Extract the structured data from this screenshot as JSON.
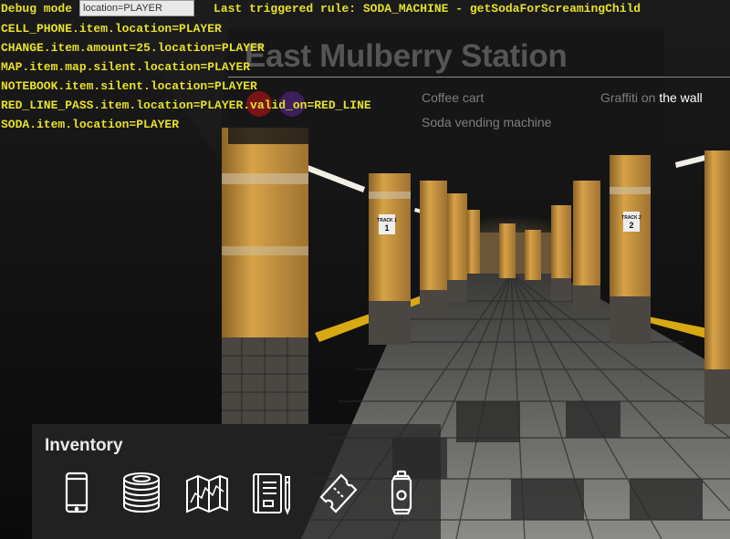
{
  "debug": {
    "mode_label": "Debug mode",
    "input_value": "location=PLAYER",
    "last_rule": "Last triggered rule: SODA_MACHINE - getSodaForScreamingChild",
    "state_lines": [
      "CELL_PHONE.item.location=PLAYER",
      "CHANGE.item.amount=25.location=PLAYER",
      "MAP.item.map.silent.location=PLAYER",
      "NOTEBOOK.item.silent.location=PLAYER",
      "RED_LINE_PASS.item.location=PLAYER.valid_on=RED_LINE",
      "SODA.item.location=PLAYER"
    ]
  },
  "location": {
    "title": "East Mulberry Station",
    "hotspots": {
      "coffee_cart": "Coffee cart",
      "soda_machine": "Soda vending machine",
      "graffiti_prefix": "Graffiti on ",
      "graffiti_suffix": "the wall"
    }
  },
  "scene": {
    "track_signs": [
      "TRACK 1",
      "TRACK 2"
    ]
  },
  "inventory": {
    "title": "Inventory",
    "items": [
      {
        "name": "cell-phone",
        "icon": "phone-icon"
      },
      {
        "name": "change",
        "icon": "coins-icon"
      },
      {
        "name": "map",
        "icon": "map-icon"
      },
      {
        "name": "notebook",
        "icon": "notebook-icon"
      },
      {
        "name": "red-line-pass",
        "icon": "ticket-icon"
      },
      {
        "name": "soda",
        "icon": "soda-can-icon"
      }
    ]
  },
  "colors": {
    "debug_text": "#e6e02a",
    "pillar_orange": "#d7a247",
    "platform_yellow": "#d9a913"
  }
}
